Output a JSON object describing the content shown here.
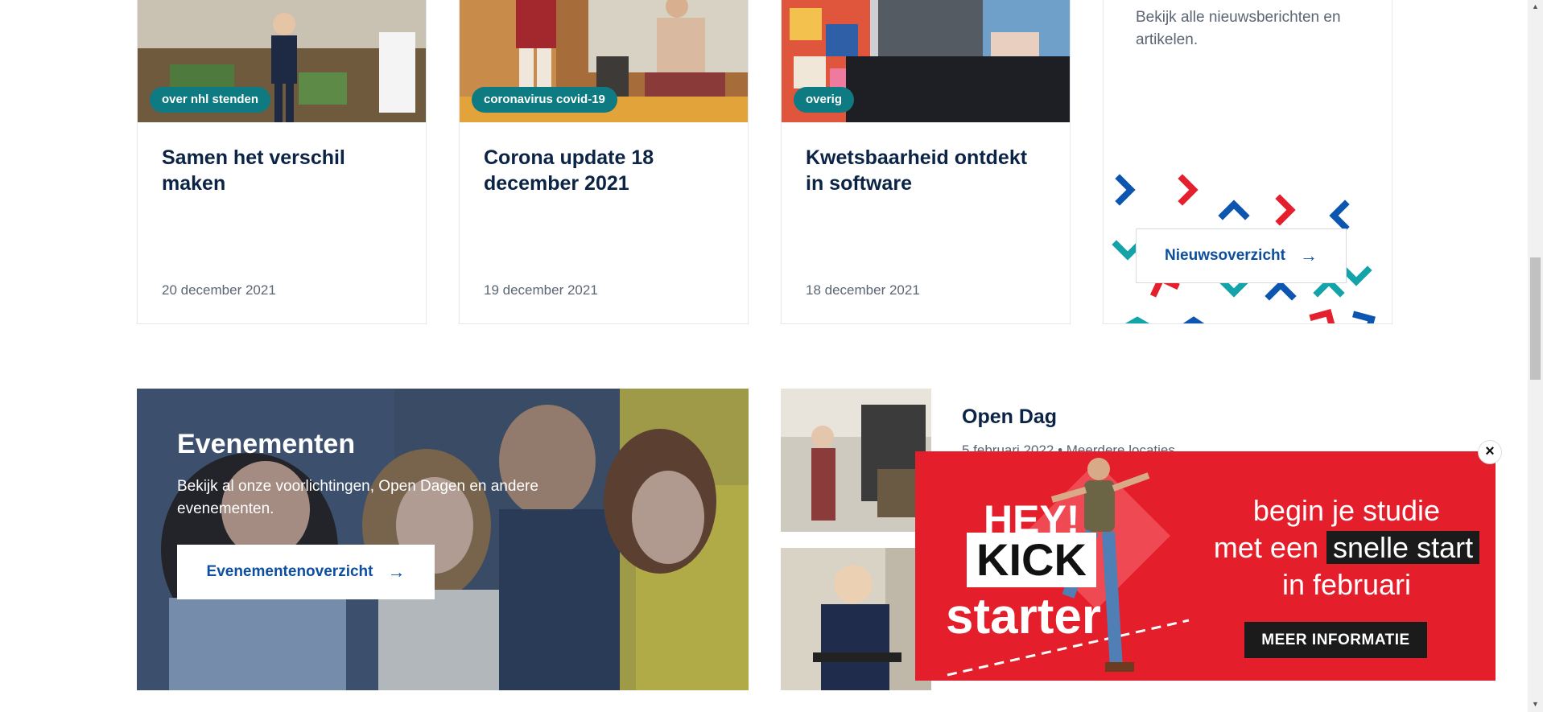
{
  "news": {
    "cards": [
      {
        "tag": "over nhl stenden",
        "title": "Samen het verschil maken",
        "date": "20 december 2021"
      },
      {
        "tag": "coronavirus covid-19",
        "title": "Corona update 18 december 2021",
        "date": "19 december 2021"
      },
      {
        "tag": "overig",
        "title": "Kwetsbaarheid ontdekt in software",
        "date": "18 december 2021"
      }
    ],
    "overview": {
      "text": "Bekijk alle nieuwsberichten en artikelen.",
      "button_label": "Nieuwsoverzicht",
      "arrow": "→"
    }
  },
  "events": {
    "title": "Evenementen",
    "description": "Bekijk al onze voorlichtingen, Open Dagen en andere evenementen.",
    "button_label": "Evenementenoverzicht",
    "arrow": "→",
    "items": [
      {
        "title": "Open Dag",
        "meta": "5 februari 2022  •  Meerdere locaties"
      }
    ]
  },
  "popup": {
    "close": "×",
    "hey": "HEY!",
    "kick": "KICK",
    "starter": "starter",
    "line1": "begin je studie",
    "line2_prefix": "met een",
    "line2_highlight": "snelle start",
    "line3": "in februari",
    "cta": "MEER INFORMATIE"
  },
  "colors": {
    "navy": "#0b2345",
    "teal_tag": "#0e7a82",
    "link_blue": "#0d4f9e",
    "popup_red": "#e41e2a",
    "chevron_blue": "#0d56b0",
    "chevron_red": "#e4202e",
    "chevron_teal": "#14a3a8"
  }
}
